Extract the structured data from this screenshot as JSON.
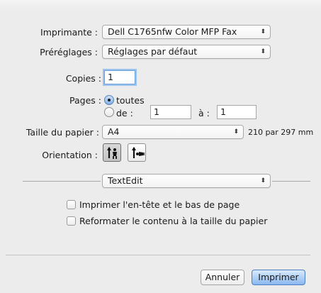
{
  "printer": {
    "label": "Imprimante :",
    "value": "Dell C1765nfw Color MFP Fax"
  },
  "presets": {
    "label": "Préréglages :",
    "value": "Réglages par défaut"
  },
  "copies": {
    "label": "Copies :",
    "value": "1"
  },
  "pages": {
    "label": "Pages :",
    "all_label": "toutes",
    "from_label": "de :",
    "from_value": "1",
    "to_label": "à :",
    "to_value": "1"
  },
  "paper_size": {
    "label": "Taille du papier :",
    "value": "A4",
    "dimensions": "210 par 297 mm"
  },
  "orientation": {
    "label": "Orientation :"
  },
  "app_section": {
    "value": "TextEdit"
  },
  "options": {
    "print_header_footer": "Imprimer l'en-tête et le bas de page",
    "rewrap_contents": "Reformater le contenu à la taille du papier"
  },
  "buttons": {
    "cancel": "Annuler",
    "print": "Imprimer"
  }
}
